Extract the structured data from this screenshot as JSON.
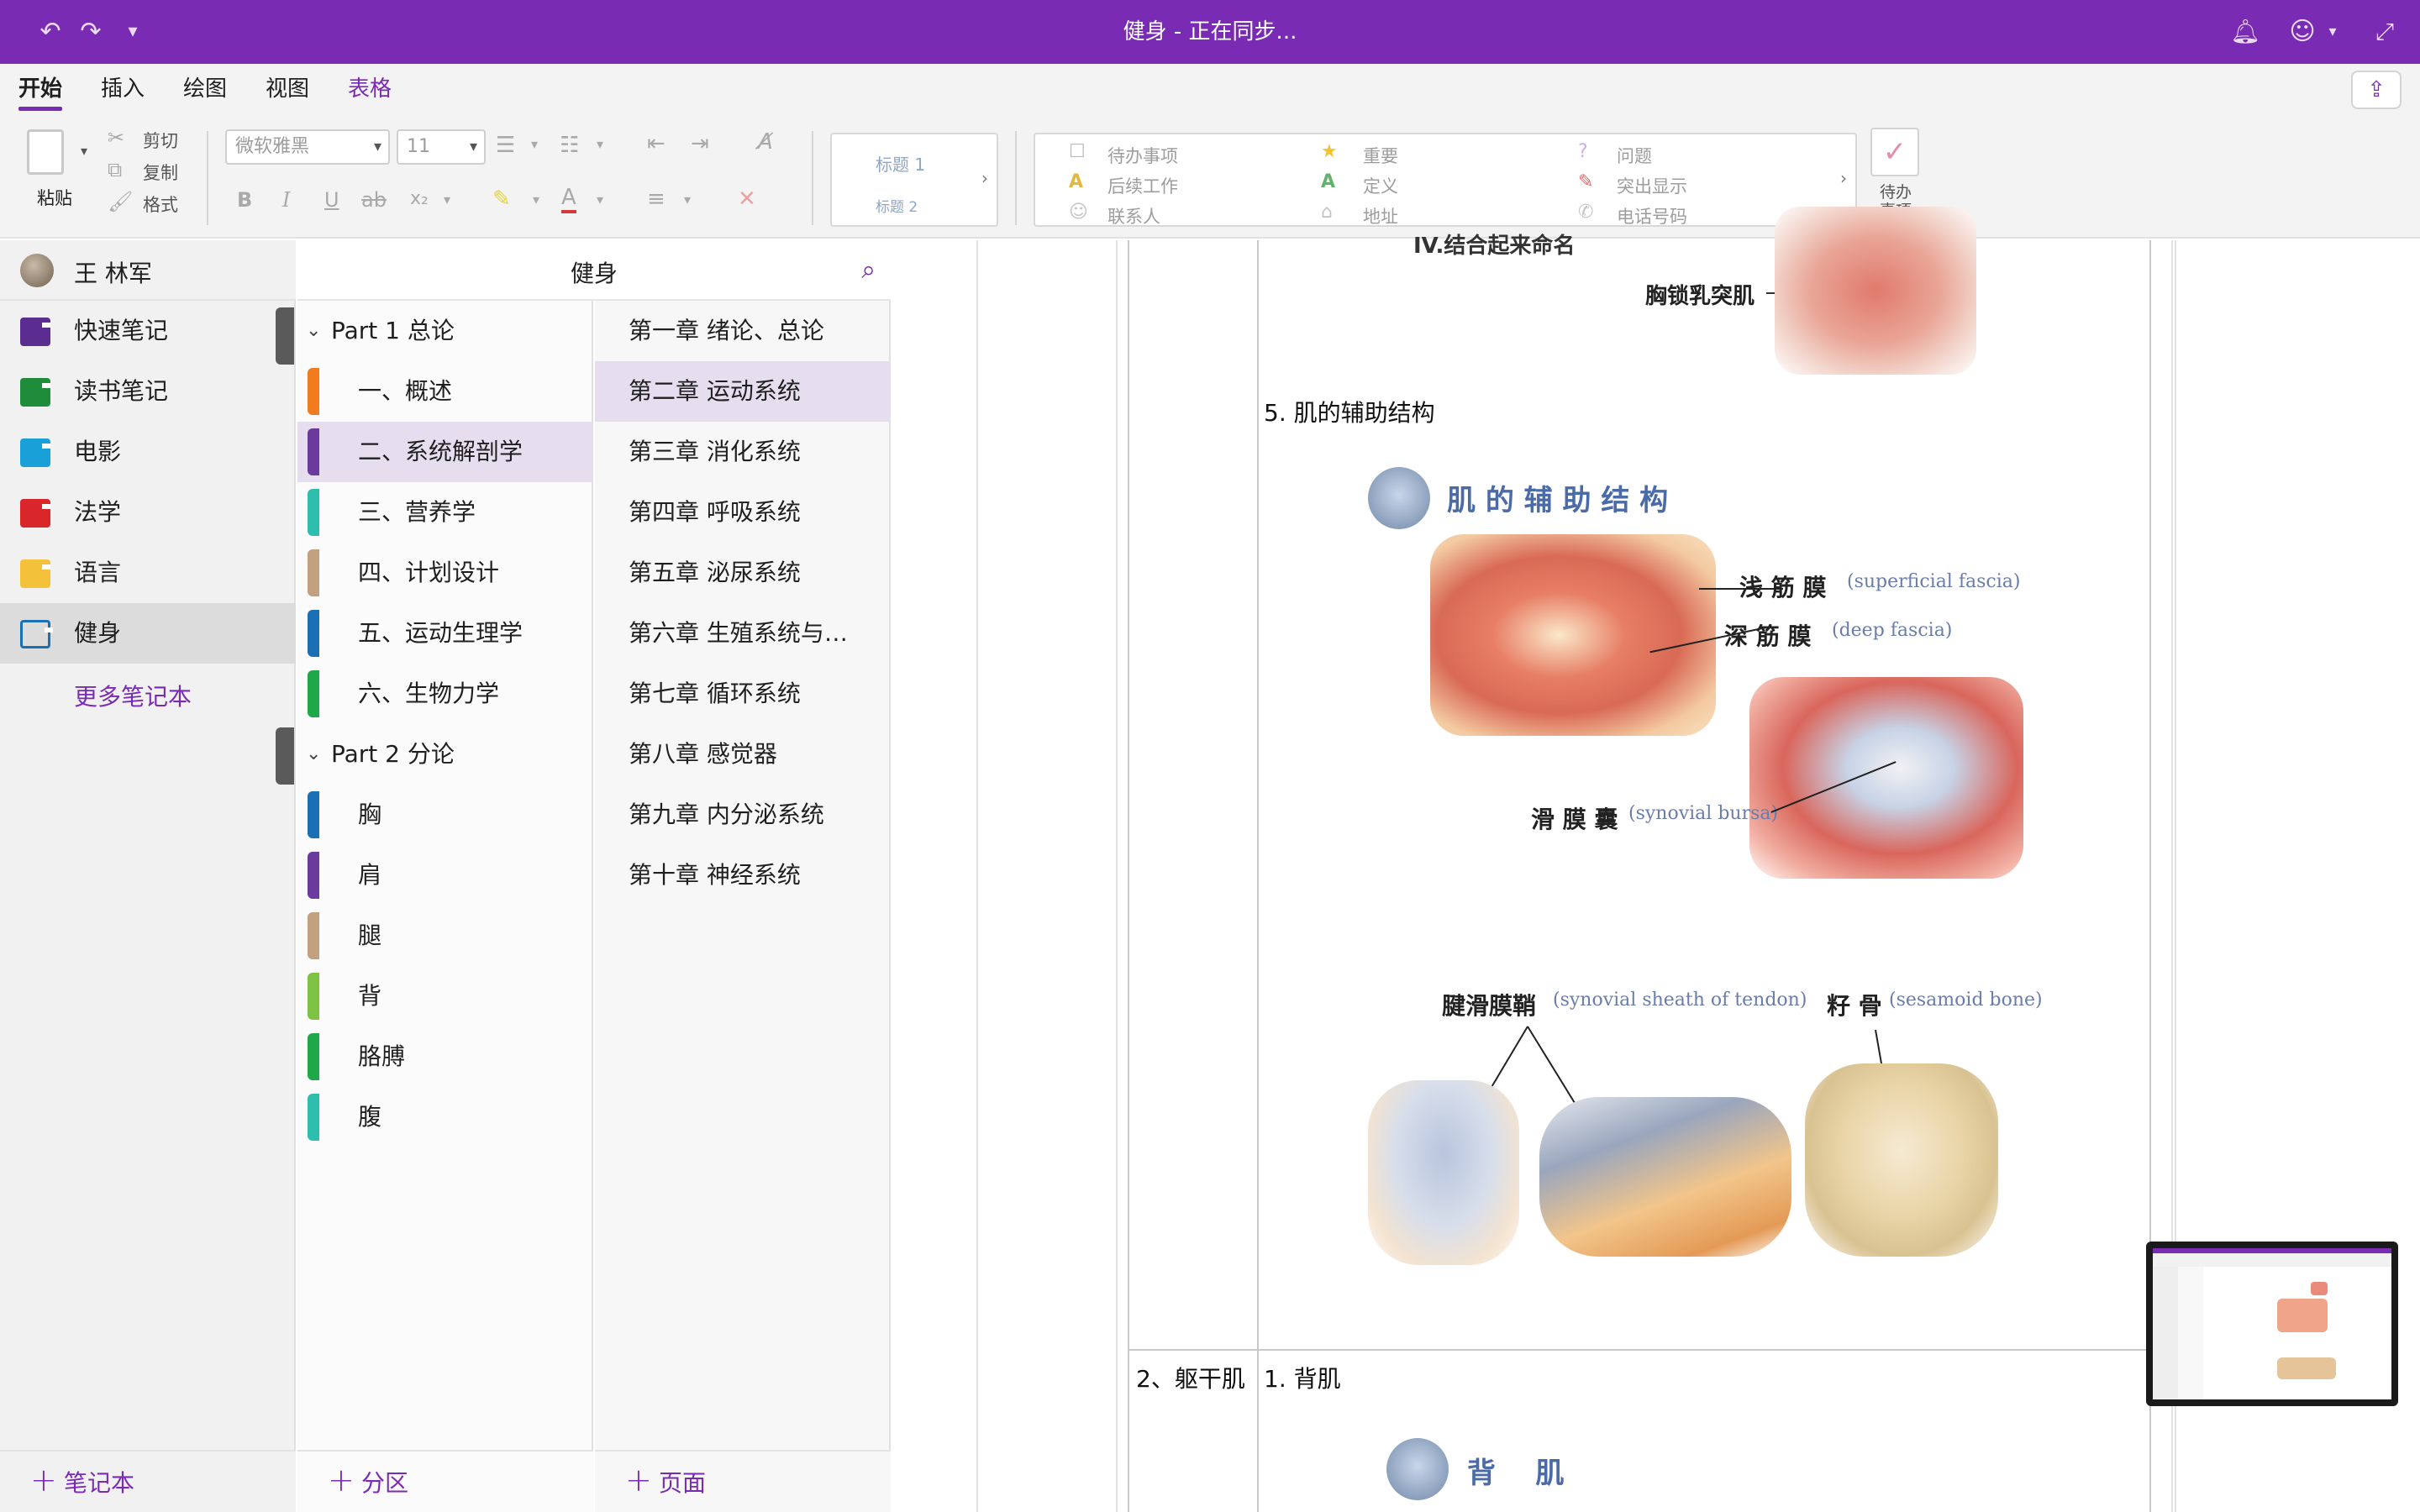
{
  "window": {
    "title": "健身 - 正在同步..."
  },
  "menu_tabs": [
    {
      "label": "开始",
      "active": true
    },
    {
      "label": "插入"
    },
    {
      "label": "绘图"
    },
    {
      "label": "视图"
    },
    {
      "label": "表格",
      "highlight": true
    }
  ],
  "ribbon": {
    "paste": "粘贴",
    "cut": "剪切",
    "copy": "复制",
    "format": "格式",
    "font_name": "微软雅黑",
    "font_size": "11",
    "style_h1": "标题 1",
    "style_h2": "标题 2",
    "tags": {
      "todo": "待办事项",
      "important": "重要",
      "question": "问题",
      "followup": "后续工作",
      "definition": "定义",
      "highlight": "突出显示",
      "contact": "联系人",
      "address": "地址",
      "phone": "电话号码"
    },
    "todo_tag_button": "待办\n事项"
  },
  "user": {
    "name": "王 林军"
  },
  "notebooks": [
    {
      "label": "快速笔记",
      "color": "#5b2d91"
    },
    {
      "label": "读书笔记",
      "color": "#1e8c3a"
    },
    {
      "label": "电影",
      "color": "#1aa0d8"
    },
    {
      "label": "法学",
      "color": "#d9262b"
    },
    {
      "label": "语言",
      "color": "#f3c23a"
    },
    {
      "label": "健身",
      "color": "#1b6fb5",
      "selected": true
    }
  ],
  "more_notebooks": "更多笔记本",
  "section_header": "健身",
  "section_groups": [
    {
      "label": "Part 1 总论",
      "sections": [
        {
          "label": "一、概述",
          "color": "#f07c1e"
        },
        {
          "label": "二、系统解剖学",
          "color": "#6a3a9c",
          "selected": true
        },
        {
          "label": "三、营养学",
          "color": "#2dbfae"
        },
        {
          "label": "四、计划设计",
          "color": "#c2a180"
        },
        {
          "label": "五、运动生理学",
          "color": "#1b6fb5"
        },
        {
          "label": "六、生物力学",
          "color": "#1fa84a"
        }
      ]
    },
    {
      "label": "Part 2 分论",
      "sections": [
        {
          "label": "胸",
          "color": "#1b6fb5"
        },
        {
          "label": "肩",
          "color": "#6a3a9c"
        },
        {
          "label": "腿",
          "color": "#c2a180"
        },
        {
          "label": "背",
          "color": "#7dc242"
        },
        {
          "label": "胳膊",
          "color": "#1fa84a"
        },
        {
          "label": "腹",
          "color": "#2dbfae"
        }
      ]
    }
  ],
  "pages": [
    {
      "label": "第一章 绪论、总论"
    },
    {
      "label": "第二章 运动系统",
      "selected": true
    },
    {
      "label": "第三章 消化系统"
    },
    {
      "label": "第四章 呼吸系统"
    },
    {
      "label": "第五章 泌尿系统"
    },
    {
      "label": "第六章 生殖系统与…"
    },
    {
      "label": "第七章 循环系统"
    },
    {
      "label": "第八章 感觉器"
    },
    {
      "label": "第九章 内分泌系统"
    },
    {
      "label": "第十章 神经系统"
    }
  ],
  "add_bar": {
    "notebook": "笔记本",
    "section": "分区",
    "page": "页面"
  },
  "content": {
    "cut_label": "IV.结合起来命名",
    "scm_label": "胸锁乳突肌",
    "item5": "5. 肌的辅助结构",
    "figure_title": "肌 的 辅 助 结 构",
    "superficial_cn": "浅 筋 膜",
    "superficial_en": "(superficial fascia)",
    "deep_cn": "深 筋 膜",
    "deep_en": "(deep fascia)",
    "bursa_cn": "滑 膜 囊",
    "bursa_en": "(synovial bursa)",
    "sheath_cn": "腱滑膜鞘",
    "sheath_en": "(synovial sheath of tendon)",
    "sesamoid_cn": "籽 骨",
    "sesamoid_en": "(sesamoid bone)",
    "row_label": "2、躯干肌",
    "item1": "1. 背肌",
    "back_title": "背    肌"
  }
}
